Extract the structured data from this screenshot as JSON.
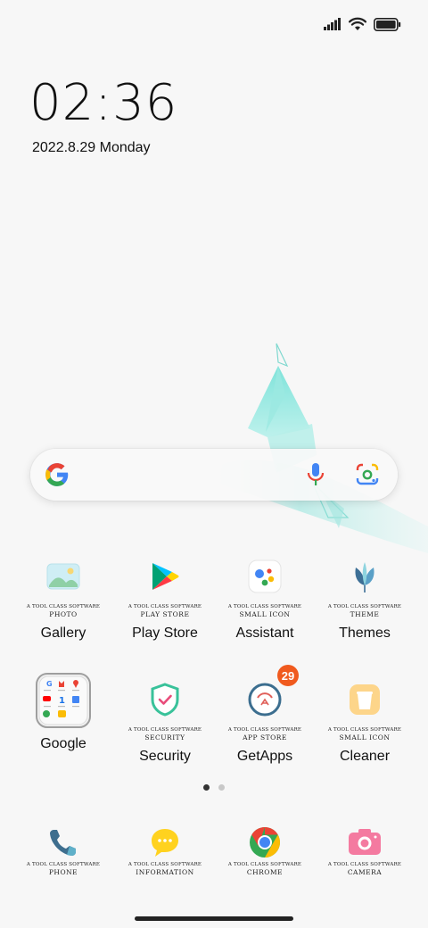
{
  "status_bar": {
    "signal_icon": "signal-bars-icon",
    "wifi_icon": "wifi-icon",
    "battery_icon": "battery-icon"
  },
  "clock": {
    "time": "02:36",
    "date": "2022.8.29 Monday"
  },
  "search": {
    "logo_icon": "google-g-icon",
    "voice_icon": "microphone-icon",
    "lens_icon": "google-lens-icon"
  },
  "apps": [
    {
      "label": "Gallery",
      "tagline": "A TOOL CLASS SOFTWARE",
      "subtitle": "PHOTO"
    },
    {
      "label": "Play Store",
      "tagline": "A TOOL CLASS SOFTWARE",
      "subtitle": "PLAY STORE"
    },
    {
      "label": "Assistant",
      "tagline": "A TOOL CLASS SOFTWARE",
      "subtitle": "SMALL ICON"
    },
    {
      "label": "Themes",
      "tagline": "A TOOL CLASS SOFTWARE",
      "subtitle": "THEME"
    },
    {
      "label": "Google",
      "tagline": "",
      "subtitle": ""
    },
    {
      "label": "Security",
      "tagline": "A TOOL CLASS SOFTWARE",
      "subtitle": "SECURITY"
    },
    {
      "label": "GetApps",
      "tagline": "A TOOL CLASS SOFTWARE",
      "subtitle": "APP STORE",
      "badge": "29"
    },
    {
      "label": "Cleaner",
      "tagline": "A TOOL CLASS SOFTWARE",
      "subtitle": "SMALL ICON"
    }
  ],
  "dock": [
    {
      "tagline": "A TOOL CLASS SOFTWARE",
      "subtitle": "PHONE"
    },
    {
      "tagline": "A TOOL CLASS SOFTWARE",
      "subtitle": "INFORMATION"
    },
    {
      "tagline": "A TOOL CLASS SOFTWARE",
      "subtitle": "CHROME"
    },
    {
      "tagline": "A TOOL CLASS SOFTWARE",
      "subtitle": "CAMERA"
    }
  ],
  "pager": {
    "current_page": 1,
    "page_count": 2
  },
  "colors": {
    "badge": "#f05a1e",
    "accent_teal": "#5fd8cf"
  }
}
